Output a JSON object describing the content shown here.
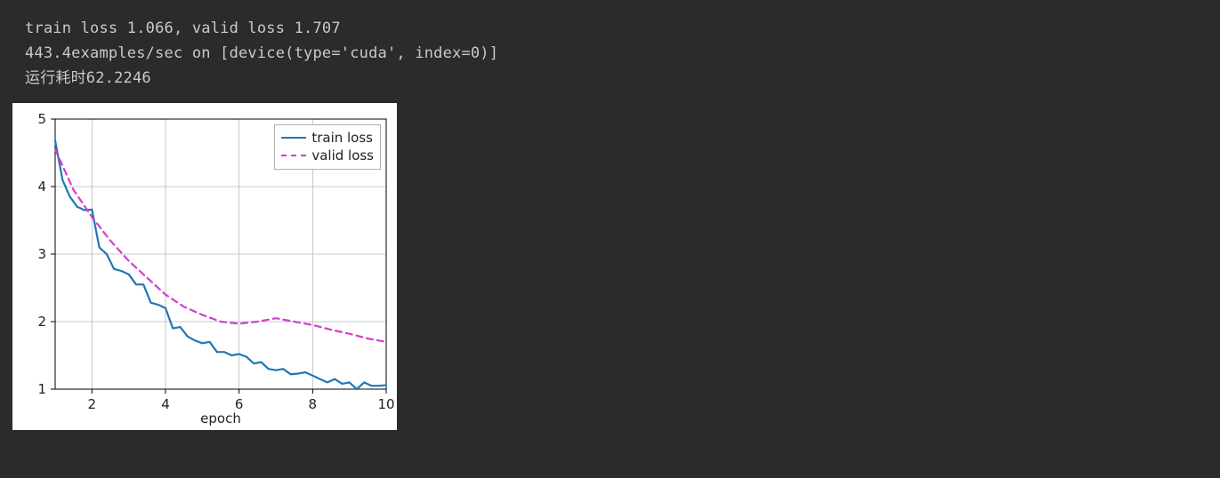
{
  "output": {
    "line1": "train loss 1.066, valid loss 1.707",
    "line2": "443.4examples/sec on [device(type='cuda', index=0)]",
    "line3": "运行耗时62.2246"
  },
  "chart_data": {
    "type": "line",
    "xlabel": "epoch",
    "ylabel": "",
    "xlim": [
      1,
      10
    ],
    "ylim": [
      1,
      5
    ],
    "xticks": [
      2,
      4,
      6,
      8,
      10
    ],
    "yticks": [
      1,
      2,
      3,
      4,
      5
    ],
    "legend": {
      "position": "upper right",
      "entries": [
        "train loss",
        "valid loss"
      ]
    },
    "grid": true,
    "series": [
      {
        "name": "train loss",
        "color": "#1f77b4",
        "style": "solid",
        "x": [
          1,
          1.2,
          1.4,
          1.6,
          1.8,
          2,
          2.2,
          2.4,
          2.6,
          2.8,
          3,
          3.2,
          3.4,
          3.6,
          3.8,
          4,
          4.2,
          4.4,
          4.6,
          4.8,
          5,
          5.2,
          5.4,
          5.6,
          5.8,
          6,
          6.2,
          6.4,
          6.6,
          6.8,
          7,
          7.2,
          7.4,
          7.6,
          7.8,
          8,
          8.2,
          8.4,
          8.6,
          8.8,
          9,
          9.2,
          9.4,
          9.6,
          9.8,
          10
        ],
        "y": [
          4.68,
          4.1,
          3.85,
          3.7,
          3.65,
          3.66,
          3.1,
          3.0,
          2.78,
          2.75,
          2.7,
          2.55,
          2.55,
          2.28,
          2.25,
          2.2,
          1.9,
          1.92,
          1.78,
          1.72,
          1.68,
          1.7,
          1.55,
          1.55,
          1.5,
          1.52,
          1.48,
          1.38,
          1.4,
          1.3,
          1.28,
          1.3,
          1.22,
          1.23,
          1.25,
          1.2,
          1.15,
          1.1,
          1.15,
          1.08,
          1.1,
          1.0,
          1.1,
          1.05,
          1.05,
          1.06
        ]
      },
      {
        "name": "valid loss",
        "color": "#d03fcf",
        "style": "dashed",
        "x": [
          1,
          1.5,
          2,
          2.5,
          3,
          3.5,
          4,
          4.5,
          5,
          5.5,
          6,
          6.5,
          7,
          7.5,
          8,
          8.5,
          9,
          9.5,
          10
        ],
        "y": [
          4.55,
          3.95,
          3.55,
          3.2,
          2.9,
          2.65,
          2.4,
          2.22,
          2.1,
          2.0,
          1.97,
          2.0,
          2.05,
          2.0,
          1.95,
          1.88,
          1.82,
          1.75,
          1.7
        ]
      }
    ]
  },
  "legend_labels": {
    "train": "train loss",
    "valid": "valid loss"
  }
}
